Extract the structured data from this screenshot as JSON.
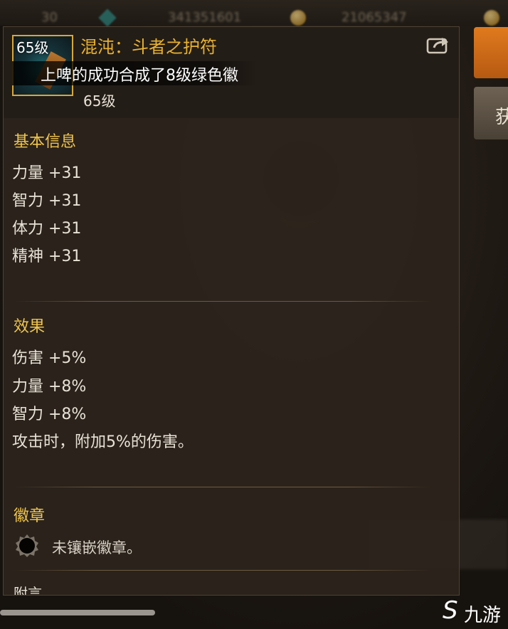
{
  "tooltip": {
    "item_name": "混沌：斗者之护符",
    "icon_level_badge": "65级",
    "item_level": "65级",
    "system_notice": "上啤的成功合成了8级绿色徽",
    "sections": {
      "basic_info": {
        "title": "基本信息",
        "stats": [
          "力量 +31",
          "智力 +31",
          "体力 +31",
          "精神 +31"
        ]
      },
      "effects": {
        "title": "效果",
        "stats": [
          "伤害 +5%",
          "力量 +8%",
          "智力 +8%",
          "攻击时，附加5%的伤害。"
        ]
      },
      "badge": {
        "title": "徽章",
        "empty_text": "未镶嵌徽章。"
      },
      "next_section_title_partial": "附言"
    }
  },
  "colors": {
    "item_name": "#e9b22f",
    "section_title": "#f0c54c",
    "icon_border": "#d9a63a",
    "stat_text": "#e8e2d6",
    "orange_button": "#e07a1e"
  },
  "icons": {
    "share": "share-export-icon",
    "badge_socket": "badge-socket-icon",
    "watermark": "site-watermark-logo"
  },
  "background": {
    "right_gray_button_label": "获",
    "watermark_text": "九游"
  }
}
